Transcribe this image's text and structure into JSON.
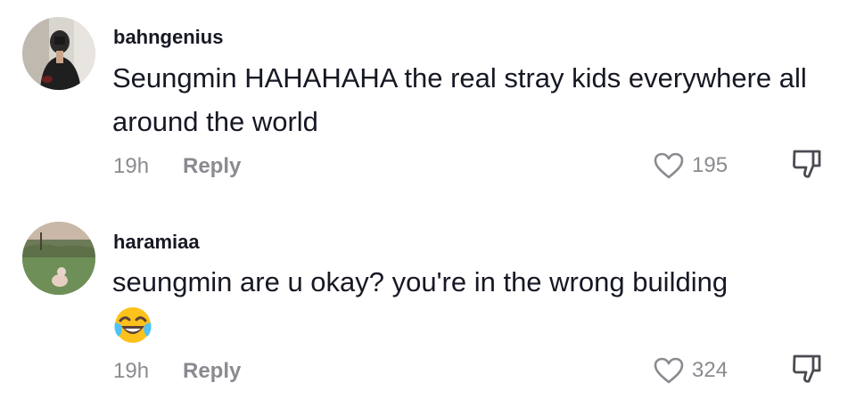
{
  "comments": [
    {
      "username": "bahngenius",
      "text": "Seungmin HAHAHAHA the real stray kids everywhere all around the world",
      "time": "19h",
      "reply_label": "Reply",
      "likes": "195",
      "avatar_icon": "user-photo-mirror-selfie",
      "like_icon": "heart-outline-icon",
      "dislike_icon": "thumbs-down-icon"
    },
    {
      "username": "haramiaa",
      "text": "seungmin are u okay? you're in the wrong building",
      "emoji": "face-with-tears-of-joy",
      "time": "19h",
      "reply_label": "Reply",
      "likes": "324",
      "avatar_icon": "user-photo-field-with-dog",
      "like_icon": "heart-outline-icon",
      "dislike_icon": "thumbs-down-icon"
    }
  ],
  "colors": {
    "primary_text": "#161823",
    "secondary_text": "#8a8b91"
  }
}
